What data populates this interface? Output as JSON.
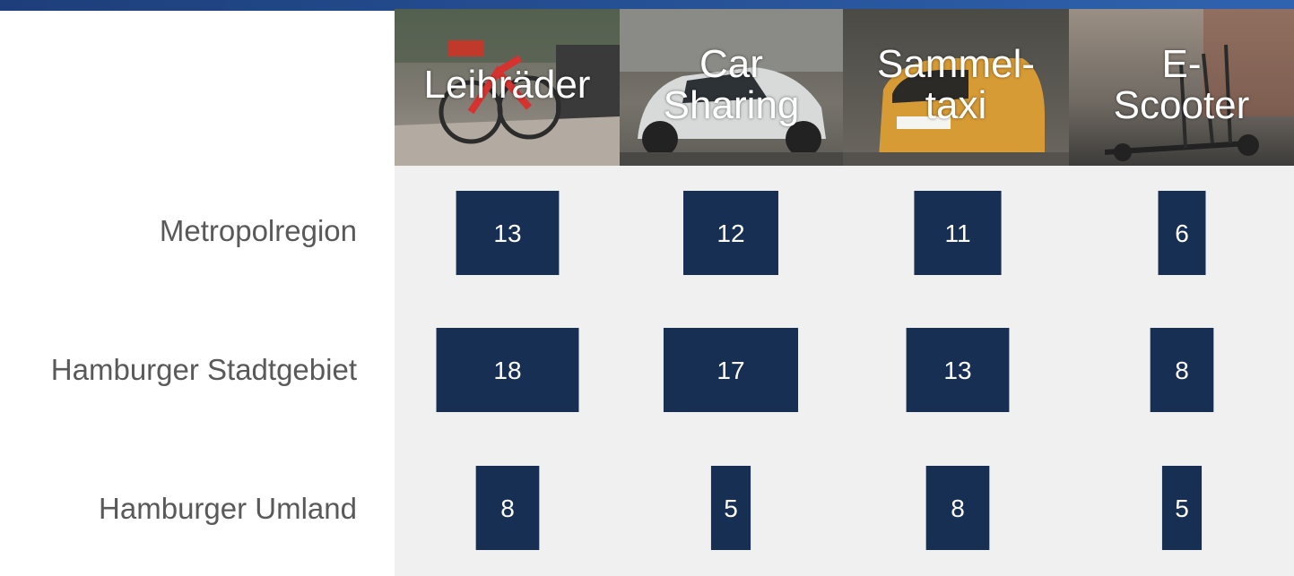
{
  "colors": {
    "bar": "#172f52",
    "panel": "#f0f0f1",
    "row_label": "#595959",
    "header_text": "#ffffff",
    "top_bar": "#2a55a0"
  },
  "chart_data": {
    "type": "table",
    "encoding": "box area proportional to value",
    "categories": [
      "Leihräder",
      "Car\nSharing",
      "Sammel-\ntaxi",
      "E-\nScooter"
    ],
    "rows": [
      "Metropolregion",
      "Hamburger Stadtgebiet",
      "Hamburger Umland"
    ],
    "series": [
      {
        "name": "Metropolregion",
        "values": [
          13,
          12,
          11,
          6
        ]
      },
      {
        "name": "Hamburger Stadtgebiet",
        "values": [
          18,
          17,
          13,
          8
        ]
      },
      {
        "name": "Hamburger Umland",
        "values": [
          8,
          5,
          8,
          5
        ]
      }
    ]
  }
}
